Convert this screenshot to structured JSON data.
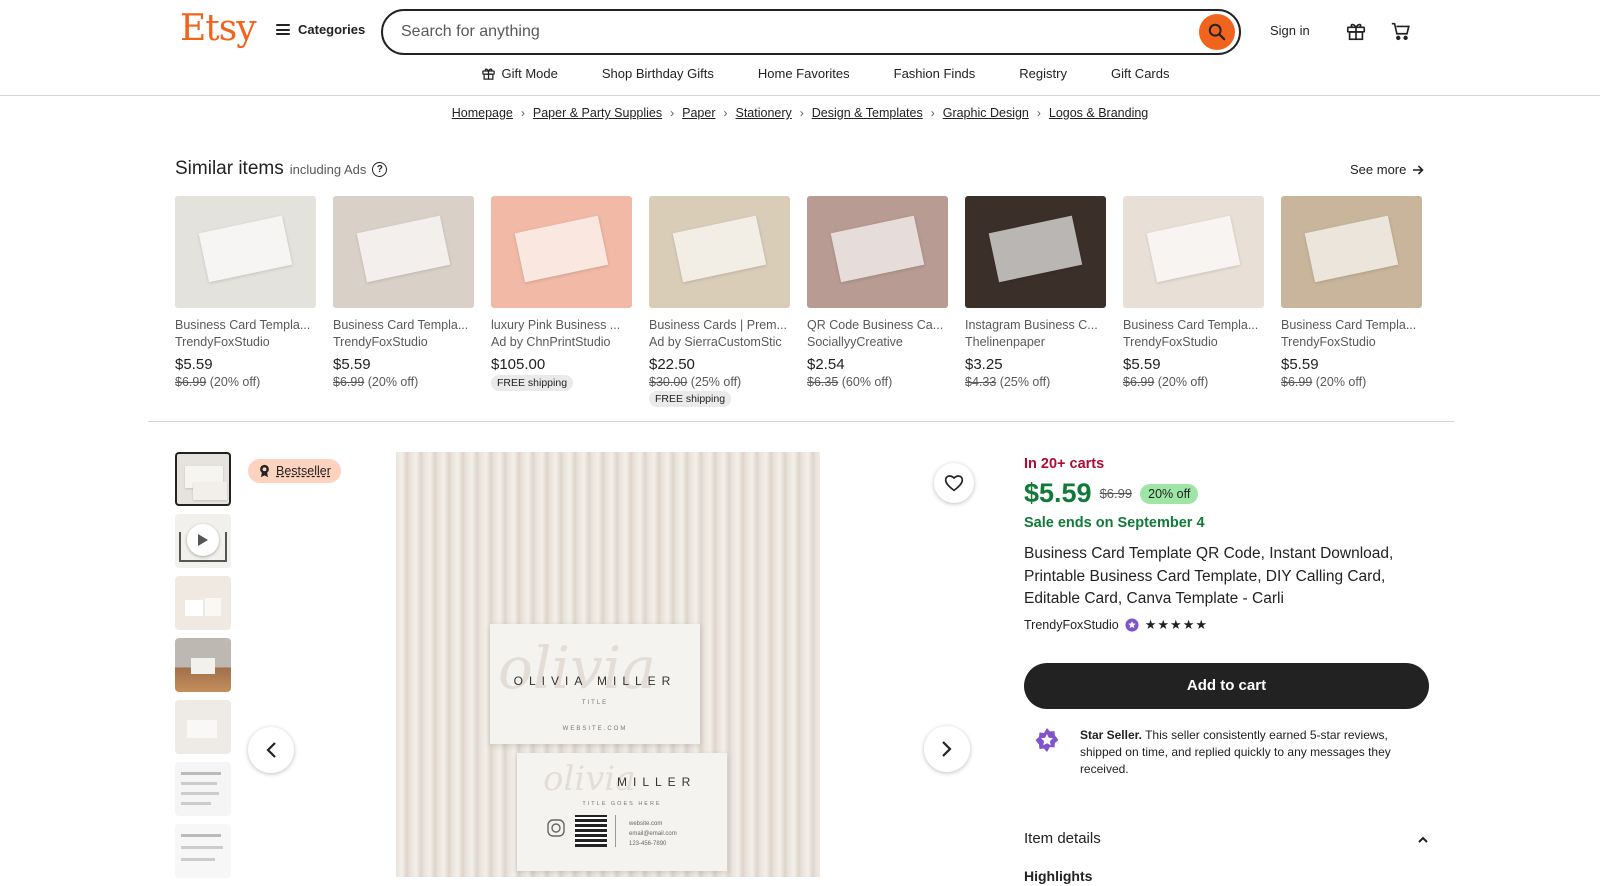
{
  "header": {
    "logo": "Etsy",
    "categories_label": "Categories",
    "search_placeholder": "Search for anything",
    "signin_label": "Sign in"
  },
  "subnav": [
    {
      "label": "Gift Mode",
      "icon": "gift-icon"
    },
    {
      "label": "Shop Birthday Gifts"
    },
    {
      "label": "Home Favorites"
    },
    {
      "label": "Fashion Finds"
    },
    {
      "label": "Registry"
    },
    {
      "label": "Gift Cards"
    }
  ],
  "breadcrumb": [
    "Homepage",
    "Paper & Party Supplies",
    "Paper",
    "Stationery",
    "Design & Templates",
    "Graphic Design",
    "Logos & Branding"
  ],
  "similar": {
    "title": "Similar items",
    "subtitle": "including Ads",
    "see_more": "See more",
    "items": [
      {
        "title": "Business Card Templa...",
        "shop": "TrendyFoxStudio",
        "price": "$5.59",
        "orig": "$6.99",
        "off": "(20% off)",
        "free": ""
      },
      {
        "title": "Business Card Templa...",
        "shop": "TrendyFoxStudio",
        "price": "$5.59",
        "orig": "$6.99",
        "off": "(20% off)",
        "free": ""
      },
      {
        "title": "luxury Pink Business ...",
        "shop": "Ad by ChnPrintStudio",
        "price": "$105.00",
        "orig": "",
        "off": "",
        "free": "FREE shipping"
      },
      {
        "title": "Business Cards | Prem...",
        "shop": "Ad by SierraCustomStic",
        "price": "$22.50",
        "orig": "$30.00",
        "off": "(25% off)",
        "free": "FREE shipping"
      },
      {
        "title": "QR Code Business Ca...",
        "shop": "SociallyyCreative",
        "price": "$2.54",
        "orig": "$6.35",
        "off": "(60% off)",
        "free": ""
      },
      {
        "title": "Instagram Business C...",
        "shop": "Thelinenpaper",
        "price": "$3.25",
        "orig": "$4.33",
        "off": "(25% off)",
        "free": ""
      },
      {
        "title": "Business Card Templa...",
        "shop": "TrendyFoxStudio",
        "price": "$5.59",
        "orig": "$6.99",
        "off": "(20% off)",
        "free": ""
      },
      {
        "title": "Business Card Templa...",
        "shop": "TrendyFoxStudio",
        "price": "$5.59",
        "orig": "$6.99",
        "off": "(20% off)",
        "free": ""
      }
    ],
    "thumb_colors": [
      "#e4e2dd",
      "#d9d1c8",
      "#f1b9a6",
      "#d9cdb8",
      "#b89b92",
      "#3b2f2a",
      "#e8e0d6",
      "#c9b59b"
    ]
  },
  "listing": {
    "bestseller": "Bestseller",
    "carts": "In 20+ carts",
    "price": "$5.59",
    "orig_price": "$6.99",
    "off": "20% off",
    "sale": "Sale ends on September 4",
    "title": "Business Card Template QR Code, Instant Download, Printable Business Card Template, DIY Calling Card, Editable Card, Canva Template - Carli",
    "shop": "TrendyFoxStudio",
    "rating_stars": "★★★★★",
    "add_to_cart": "Add to cart",
    "star_seller_bold": "Star Seller.",
    "star_seller_text": " This seller consistently earned 5-star reviews, shipped on time, and replied quickly to any messages they received.",
    "item_details": "Item details",
    "highlights": "Highlights",
    "card_front_name": "OLIVIA MILLER",
    "card_front_sub": "TITLE",
    "card_front_site": "WEBSITE.COM",
    "card_back_name": "MILLER",
    "card_back_title": "TITLE GOES HERE",
    "card_back_lines": [
      "website.com",
      "email@email.com",
      "123-456-7890"
    ]
  },
  "colors": {
    "brand": "#f1641e",
    "sale_green": "#117a38",
    "carts_red": "#b30a35",
    "badge_green": "#9ee5a6",
    "bestseller_bg": "#fdd3bf"
  }
}
